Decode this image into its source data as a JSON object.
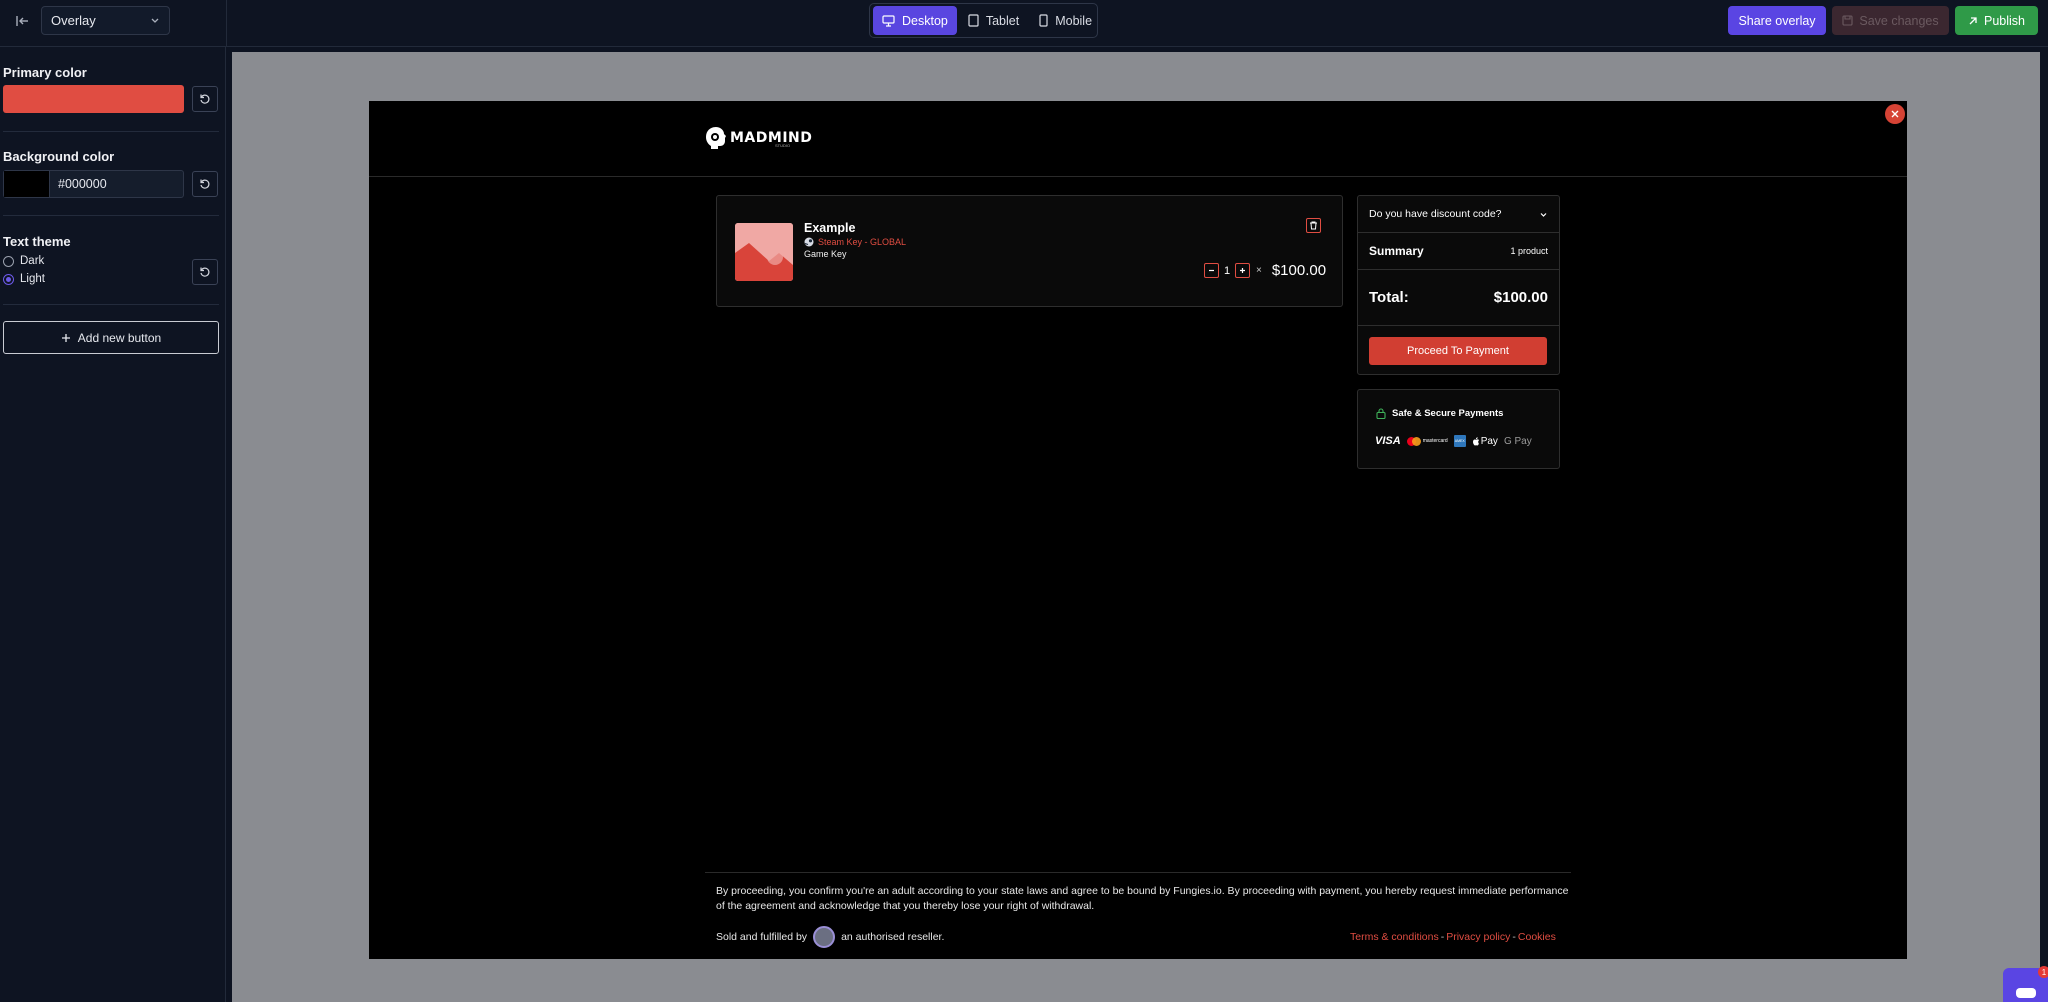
{
  "topbar": {
    "overlay_select": "Overlay",
    "devices": [
      {
        "label": "Desktop",
        "icon": "monitor-icon",
        "active": true
      },
      {
        "label": "Tablet",
        "icon": "tablet-icon",
        "active": false
      },
      {
        "label": "Mobile",
        "icon": "phone-icon",
        "active": false
      }
    ],
    "share_label": "Share overlay",
    "save_label": "Save changes",
    "publish_label": "Publish"
  },
  "sidebar": {
    "primary_color": {
      "label": "Primary color",
      "value": "#e04d42"
    },
    "background_color": {
      "label": "Background color",
      "value": "#000000"
    },
    "text_theme": {
      "label": "Text theme",
      "options": [
        {
          "label": "Dark",
          "checked": false
        },
        {
          "label": "Light",
          "checked": true
        }
      ]
    },
    "add_button_label": "Add new button"
  },
  "overlay": {
    "logo_text": "MADMIND",
    "logo_subtext": "STUDIO",
    "item": {
      "name": "Example",
      "platform": "Steam Key - GLOBAL",
      "type": "Game Key",
      "quantity": "1",
      "times": "×",
      "price": "$100.00"
    },
    "summary": {
      "discount_label": "Do you have discount code?",
      "summary_label": "Summary",
      "product_count": "1 product",
      "total_label": "Total:",
      "total_value": "$100.00",
      "pay_button": "Proceed To Payment"
    },
    "secure": {
      "title": "Safe & Secure Payments",
      "methods": [
        "VISA",
        "mastercard",
        "AMEX",
        "Pay",
        "G Pay"
      ]
    },
    "disclaimer": "By proceeding, you confirm you're an adult according to your state laws and agree to be bound by Fungies.io. By proceeding with payment, you hereby request immediate performance of the agreement and acknowledge that you thereby lose your right of withdrawal.",
    "sold_prefix": "Sold and fulfilled by",
    "sold_suffix": "an authorised reseller.",
    "legal": {
      "terms": "Terms & conditions",
      "privacy": "Privacy policy",
      "cookies": "Cookies",
      "separator": "-"
    }
  },
  "chat": {
    "badge": "1"
  },
  "colors": {
    "accent": "#5a45e3",
    "primary": "#e04d42",
    "publish": "#2f9a48"
  }
}
